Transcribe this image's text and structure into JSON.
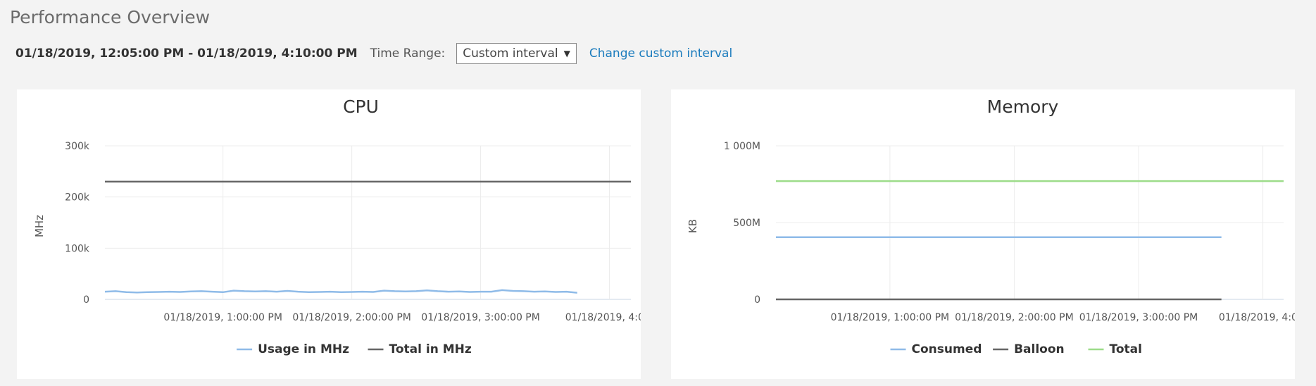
{
  "page": {
    "title": "Performance Overview"
  },
  "toolbar": {
    "range_text": "01/18/2019, 12:05:00 PM - 01/18/2019, 4:10:00 PM",
    "time_range_label": "Time Range:",
    "time_range_value": "Custom interval",
    "change_link": "Change custom interval"
  },
  "icons": {
    "dropdown": "caret-down-icon"
  },
  "chart_data": [
    {
      "type": "line",
      "title": "CPU",
      "ylabel": "MHz",
      "xlabel": "",
      "ylim": [
        0,
        300000
      ],
      "yticks": [
        {
          "value": 0,
          "label": "0"
        },
        {
          "value": 100000,
          "label": "100k"
        },
        {
          "value": 200000,
          "label": "200k"
        },
        {
          "value": 300000,
          "label": "300k"
        }
      ],
      "xlim": [
        0,
        245
      ],
      "xticks": [
        {
          "value": 55,
          "label": "01/18/2019, 1:00:00 PM"
        },
        {
          "value": 115,
          "label": "01/18/2019, 2:00:00 PM"
        },
        {
          "value": 175,
          "label": "01/18/2019, 3:00:00 PM"
        },
        {
          "value": 235,
          "label": "01/18/2019, 4:0..."
        }
      ],
      "grid": true,
      "legend_position": "bottom",
      "series": [
        {
          "name": "Usage in MHz",
          "color": "#8fbbe8",
          "x": [
            0,
            5,
            10,
            15,
            20,
            25,
            30,
            35,
            40,
            45,
            50,
            55,
            60,
            65,
            70,
            75,
            80,
            85,
            90,
            95,
            100,
            105,
            110,
            115,
            120,
            125,
            130,
            135,
            140,
            145,
            150,
            155,
            160,
            165,
            170,
            175,
            180,
            185,
            190,
            195,
            200,
            205,
            210,
            215,
            220
          ],
          "values": [
            15000,
            16000,
            14000,
            13500,
            14000,
            14500,
            15000,
            14500,
            15500,
            16000,
            15000,
            14000,
            17000,
            16000,
            15500,
            16000,
            15000,
            16500,
            15000,
            14000,
            14500,
            15000,
            14000,
            14500,
            15000,
            14500,
            17000,
            16000,
            15500,
            16000,
            17500,
            16000,
            15000,
            15500,
            14500,
            15000,
            15000,
            18000,
            16500,
            16000,
            15000,
            15500,
            14500,
            15000,
            13000
          ]
        },
        {
          "name": "Total in MHz",
          "color": "#666666",
          "x": [
            0,
            245
          ],
          "values": [
            230000,
            230000
          ]
        }
      ]
    },
    {
      "type": "line",
      "title": "Memory",
      "ylabel": "KB",
      "xlabel": "",
      "ylim": [
        0,
        1000000000
      ],
      "yticks": [
        {
          "value": 0,
          "label": "0"
        },
        {
          "value": 500000000,
          "label": "500M"
        },
        {
          "value": 1000000000,
          "label": "1 000M"
        }
      ],
      "xlim": [
        0,
        245
      ],
      "xticks": [
        {
          "value": 55,
          "label": "01/18/2019, 1:00:00 PM"
        },
        {
          "value": 115,
          "label": "01/18/2019, 2:00:00 PM"
        },
        {
          "value": 175,
          "label": "01/18/2019, 3:00:00 PM"
        },
        {
          "value": 235,
          "label": "01/18/2019, 4:0..."
        }
      ],
      "grid": true,
      "legend_position": "bottom",
      "series": [
        {
          "name": "Consumed",
          "color": "#8fbbe8",
          "x": [
            0,
            215
          ],
          "values": [
            405000000,
            405000000
          ]
        },
        {
          "name": "Balloon",
          "color": "#666666",
          "x": [
            0,
            215
          ],
          "values": [
            0,
            0
          ]
        },
        {
          "name": "Total",
          "color": "#9ddc8a",
          "x": [
            0,
            245
          ],
          "values": [
            770000000,
            770000000
          ]
        }
      ]
    }
  ]
}
